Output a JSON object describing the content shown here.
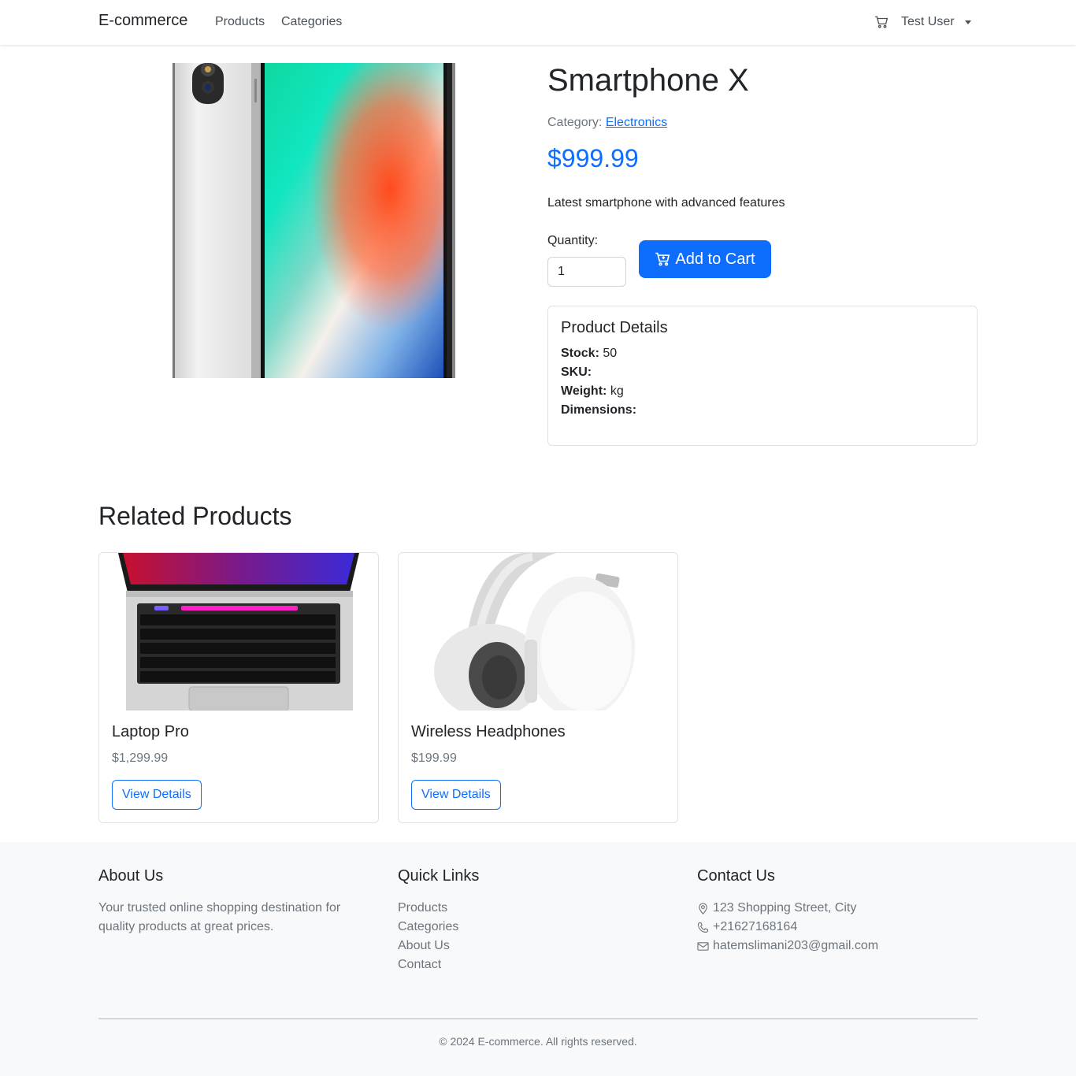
{
  "navbar": {
    "brand": "E-commerce",
    "links": [
      "Products",
      "Categories"
    ],
    "cart_icon": "cart-icon",
    "user": "Test User"
  },
  "product": {
    "title": "Smartphone X",
    "category_label": "Category: ",
    "category": "Electronics",
    "price": "$999.99",
    "description": "Latest smartphone with advanced features",
    "quantity_label": "Quantity:",
    "quantity_value": "1",
    "add_to_cart": "Add to Cart",
    "details": {
      "title": "Product Details",
      "stock_label": "Stock:",
      "stock_value": "50",
      "sku_label": "SKU:",
      "sku_value": "",
      "weight_label": "Weight:",
      "weight_value": "kg",
      "dimensions_label": "Dimensions:",
      "dimensions_value": ""
    }
  },
  "related": {
    "heading": "Related Products",
    "items": [
      {
        "name": "Laptop Pro",
        "price": "$1,299.99",
        "button": "View Details"
      },
      {
        "name": "Wireless Headphones",
        "price": "$199.99",
        "button": "View Details"
      }
    ]
  },
  "footer": {
    "about": {
      "title": "About Us",
      "text": "Your trusted online shopping destination for quality products at great prices."
    },
    "quick_links": {
      "title": "Quick Links",
      "items": [
        "Products",
        "Categories",
        "About Us",
        "Contact"
      ]
    },
    "contact": {
      "title": "Contact Us",
      "address": "123 Shopping Street, City",
      "phone": "+21627168164",
      "email": "hatemslimani203@gmail.com"
    },
    "copyright": "© 2024 E-commerce. All rights reserved."
  },
  "colors": {
    "primary": "#0d6efd",
    "muted": "#6c757d",
    "footer_bg": "#f8f9fa"
  }
}
